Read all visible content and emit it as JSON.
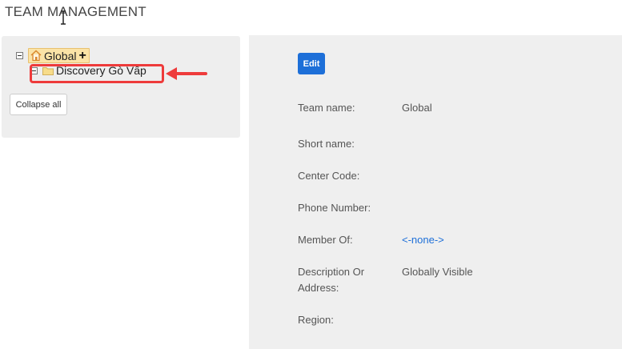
{
  "page": {
    "title": "TEAM MANAGEMENT"
  },
  "tree": {
    "root_label": "Global",
    "root_add_symbol": "+",
    "child_label": "Discovery Gò Vấp",
    "collapse_all_label": "Collapse all"
  },
  "details": {
    "edit_label": "Edit",
    "fields": [
      {
        "label": "Team name:",
        "value": "Global"
      },
      {
        "label": "Short name:",
        "value": ""
      },
      {
        "label": "Center Code:",
        "value": ""
      },
      {
        "label": "Phone Number:",
        "value": ""
      },
      {
        "label": "Member Of:",
        "value": "<-none->"
      },
      {
        "label": "Description Or Address:",
        "value": "Globally Visible"
      },
      {
        "label": "Region:",
        "value": ""
      }
    ]
  },
  "colors": {
    "accent": "#1d6fd8",
    "highlight_annotation": "#ee3b3b",
    "selected_node_bg": "#fbe3a6"
  },
  "icons": {
    "root": "home-icon",
    "child": "folder-icon",
    "add": "plus-icon",
    "annotation": "red-arrow-icon"
  }
}
